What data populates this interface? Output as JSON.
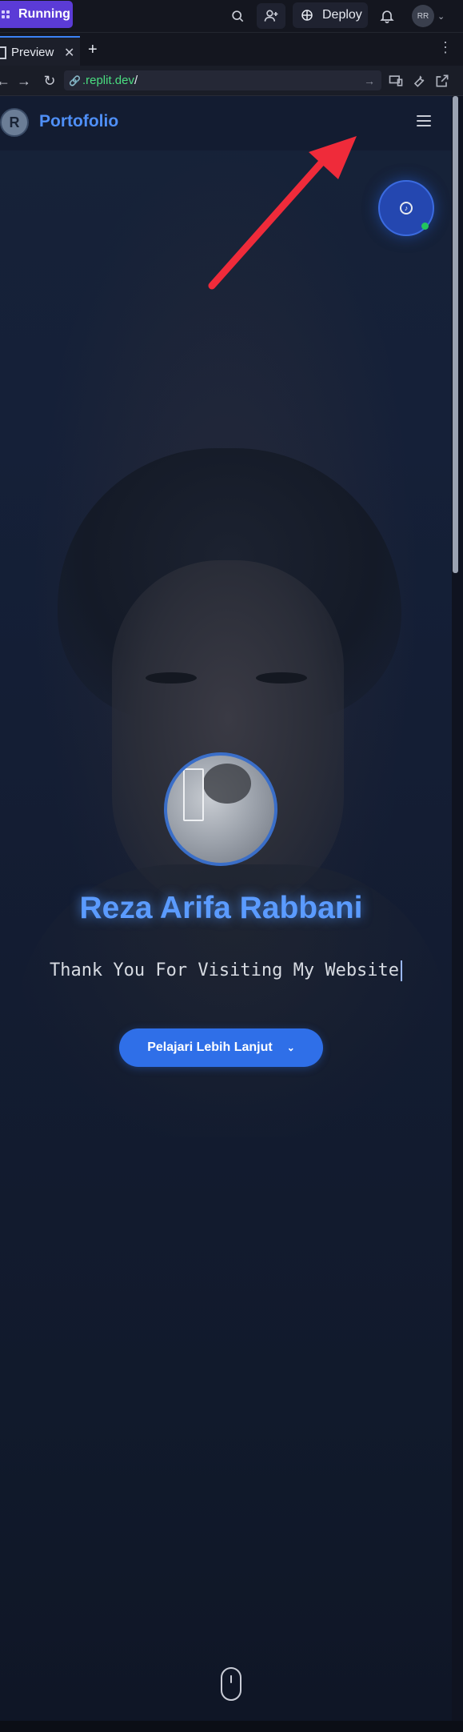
{
  "topbar": {
    "run_label": "Running",
    "deploy_label": "Deploy",
    "user_initials": "RR"
  },
  "tabs": [
    {
      "label": "Preview"
    }
  ],
  "address": {
    "url_text": ".replit.dev",
    "url_suffix": "/"
  },
  "site": {
    "brand": "Portofolio",
    "logo_letter": "R",
    "hero_name": "Reza Arifa Rabbani",
    "tagline": "Thank You For Visiting My Website",
    "cta_label": "Pelajari Lebih Lanjut"
  },
  "icons": {
    "search": "search-icon",
    "invite": "add-user-icon",
    "deploy": "deploy-icon",
    "bell": "bell-icon",
    "menu": "hamburger-icon",
    "music": "music-icon",
    "scroll": "mouse-scroll-icon"
  },
  "colors": {
    "accent": "#3b82f6",
    "run_button": "#5b3bd6",
    "brand_text": "#4f8ff7",
    "cta": "#2f6fe8",
    "annotation_arrow": "#ef2b3a",
    "url_text": "#4ade80"
  }
}
